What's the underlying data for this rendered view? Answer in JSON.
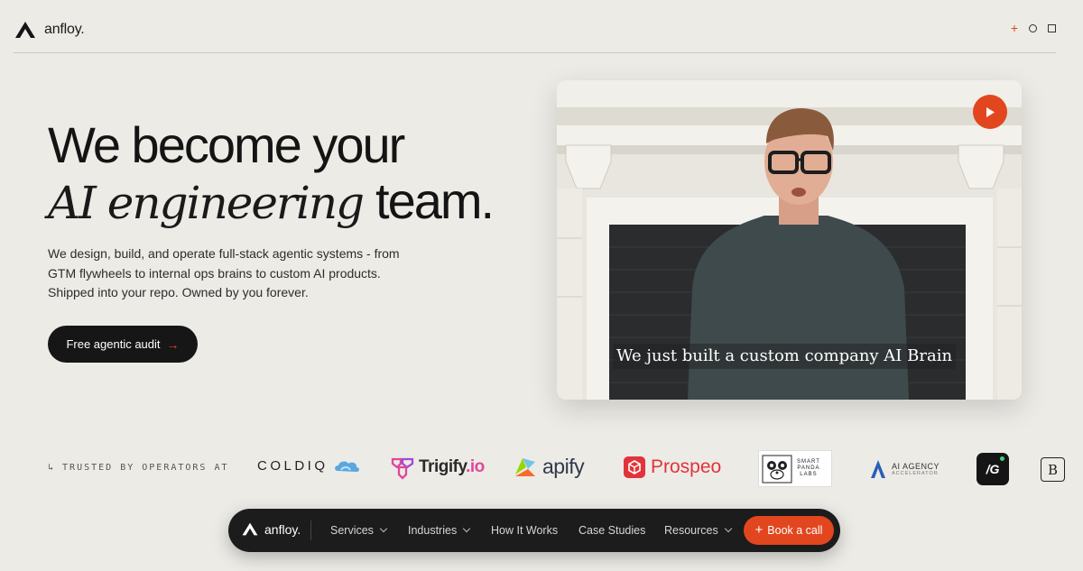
{
  "header": {
    "brand": "anfloy.",
    "icons": [
      "plus-icon",
      "circle-icon",
      "square-icon"
    ]
  },
  "hero": {
    "line1": "We become your",
    "line2_italic": "AI engineering",
    "line2_rest": "team.",
    "description": "We design, build, and operate full-stack agentic systems - from GTM flywheels to internal ops brains to custom AI products. Shipped into your repo. Owned by you forever.",
    "cta_label": "Free agentic audit",
    "cta_arrow": "→"
  },
  "video": {
    "caption": "We just built a custom company AI Brain",
    "play_icon": "play-icon"
  },
  "trusted": {
    "label": "↳ TRUSTED BY OPERATORS AT",
    "logos": {
      "coldiq": "COLDIQ",
      "trigify": "Trigify",
      "trigify_suffix": ".io",
      "apify": "apify",
      "prospeo": "Prospeo",
      "spl_1": "SMART",
      "spl_2": "PANDA",
      "spl_3": "LABS",
      "aiagency_title": "AI AGENCY",
      "aiagency_sub": "ACCELERATOR",
      "ig": "/G",
      "b": "B"
    }
  },
  "bottom_nav": {
    "brand": "anfloy.",
    "items": [
      {
        "label": "Services",
        "dropdown": true
      },
      {
        "label": "Industries",
        "dropdown": true
      },
      {
        "label": "How It Works",
        "dropdown": false
      },
      {
        "label": "Case Studies",
        "dropdown": false
      },
      {
        "label": "Resources",
        "dropdown": true
      }
    ],
    "book_label": "Book a call",
    "book_plus": "+"
  },
  "colors": {
    "accent": "#e2461f",
    "background": "#ecebe6",
    "dark": "#161616"
  }
}
